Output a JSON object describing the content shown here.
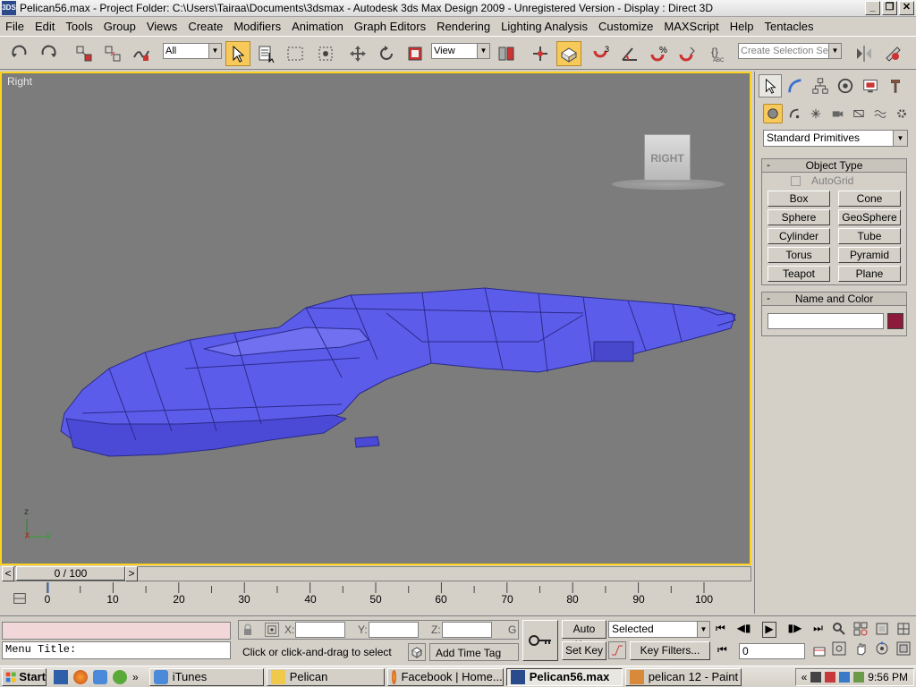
{
  "window": {
    "title": "Pelican56.max     - Project Folder: C:\\Users\\Tairaa\\Documents\\3dsmax      - Autodesk 3ds Max Design 2009    - Unregistered Version      - Display : Direct 3D",
    "icon_text": "3DS",
    "minimize": "_",
    "maximize": "❐",
    "close": "✕"
  },
  "menu": [
    "File",
    "Edit",
    "Tools",
    "Group",
    "Views",
    "Create",
    "Modifiers",
    "Animation",
    "Graph Editors",
    "Rendering",
    "Lighting Analysis",
    "Customize",
    "MAXScript",
    "Help",
    "Tentacles"
  ],
  "toolbar": {
    "selection_filter": "All",
    "ref_coord": "View",
    "snap_angle_label": "3",
    "named_selection_placeholder": "Create Selection Set"
  },
  "viewport": {
    "label": "Right",
    "viewcube_label": "RIGHT",
    "axis_z": "z",
    "axis_x": "x",
    "axis_y": "y",
    "model_color": "#5a5ae6",
    "border_color": "#ffd21f"
  },
  "command_panel": {
    "category": "Standard Primitives",
    "object_type_header": "Object Type",
    "autogrid": "AutoGrid",
    "buttons": [
      "Box",
      "Cone",
      "Sphere",
      "GeoSphere",
      "Cylinder",
      "Tube",
      "Torus",
      "Pyramid",
      "Teapot",
      "Plane"
    ],
    "name_color_header": "Name and Color",
    "name_value": "",
    "color_swatch": "#8c1a3a",
    "collapse": "-"
  },
  "timeline": {
    "frame_display": "0 / 100",
    "prev": "<",
    "next": ">",
    "ticks": [
      "0",
      "10",
      "20",
      "30",
      "40",
      "50",
      "60",
      "70",
      "80",
      "90",
      "100"
    ]
  },
  "status": {
    "listener_text": "",
    "menu_title": "Menu Title:",
    "prompt": "Click or click-and-drag to select object",
    "add_time_tag": "Add Time Tag",
    "x_label": "X:",
    "y_label": "Y:",
    "z_label": "Z:",
    "g_label": "G",
    "auto_key": "Auto Key",
    "set_key": "Set Key",
    "key_mode": "Selected",
    "key_filters": "Key Filters...",
    "frame_value": "0"
  },
  "taskbar": {
    "start": "Start",
    "overflow": "»",
    "tasks": [
      {
        "label": "iTunes",
        "active": false
      },
      {
        "label": "Pelican",
        "active": false
      },
      {
        "label": "Facebook | Home...",
        "active": false
      },
      {
        "label": "Pelican56.max",
        "active": true
      },
      {
        "label": "pelican 12 - Paint",
        "active": false
      }
    ],
    "tray_chevron": "«",
    "clock": "9:56 PM"
  }
}
